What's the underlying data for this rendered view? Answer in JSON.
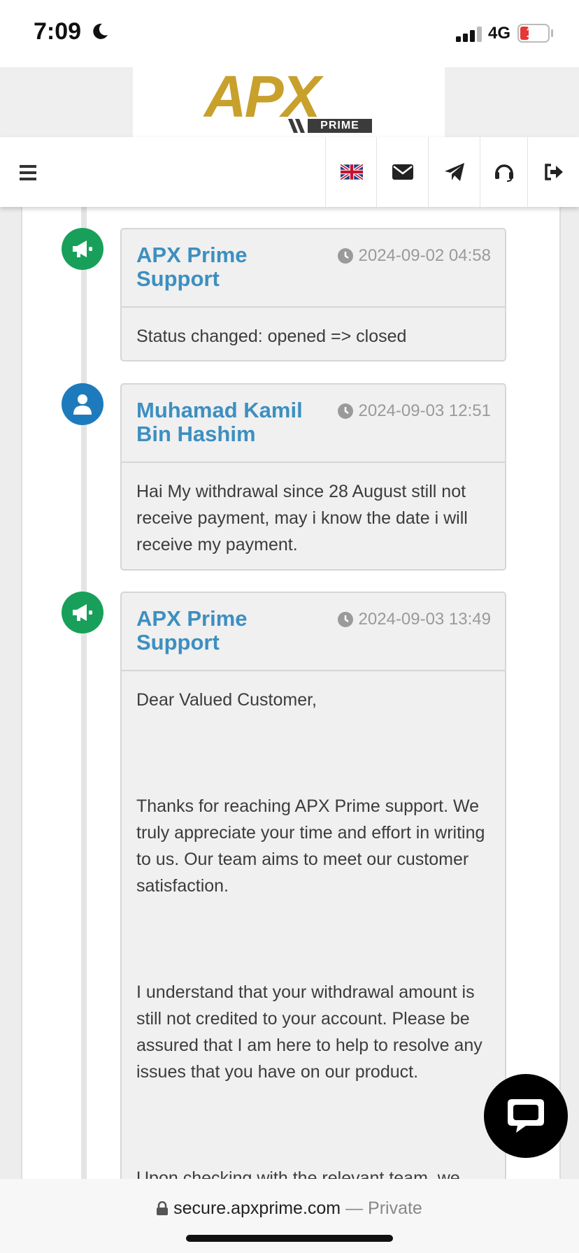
{
  "status_bar": {
    "time": "7:09",
    "network": "4G",
    "battery": "12"
  },
  "logo": {
    "text": "APX",
    "sub": "PRIME"
  },
  "navbar": {
    "icons": [
      "menu-icon",
      "uk-flag-icon",
      "envelope-icon",
      "paper-plane-icon",
      "headset-icon",
      "sign-out-icon"
    ]
  },
  "messages": [
    {
      "author": "APX Prime Support",
      "timestamp": "2024-09-02 04:58",
      "role": "support",
      "body": [
        "Status changed: opened => closed"
      ]
    },
    {
      "author": "Muhamad Kamil Bin Hashim",
      "timestamp": "2024-09-03 12:51",
      "role": "user",
      "body": [
        "Hai My withdrawal since 28 August still not receive payment, may i know the date i will receive my payment."
      ]
    },
    {
      "author": "APX Prime Support",
      "timestamp": "2024-09-03 13:49",
      "role": "support",
      "body": [
        "Dear Valued Customer,",
        "Thanks for reaching APX Prime support. We truly appreciate your time and effort in writing to us. Our team aims to meet our customer satisfaction.",
        "I understand that your withdrawal amount is still not credited to your account. Please be assured that I am here to help to resolve any issues that you have on our product.",
        "Upon checking with the relevant team, we"
      ]
    }
  ],
  "browser": {
    "domain": "secure.apxprime.com",
    "mode": "— Private"
  },
  "colors": {
    "support_badge": "#18a05a",
    "user_badge": "#1d7bbd",
    "author": "#3d8fc0",
    "logo_gold": "#c8a02c"
  }
}
